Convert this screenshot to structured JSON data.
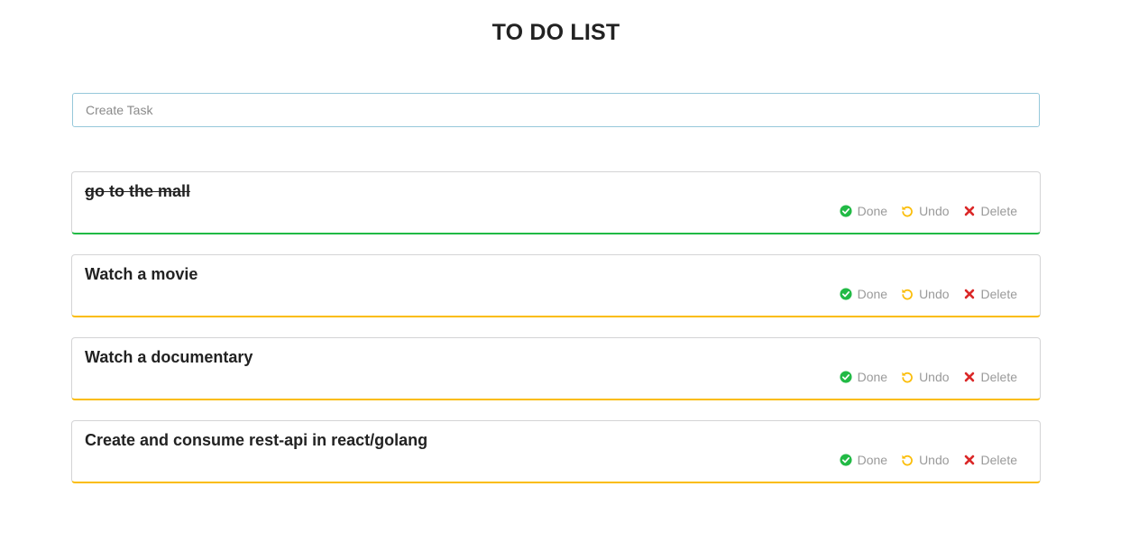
{
  "header": {
    "title": "TO DO LIST"
  },
  "create_task": {
    "placeholder": "Create Task",
    "value": ""
  },
  "actions": {
    "done_label": "Done",
    "undo_label": "Undo",
    "delete_label": "Delete"
  },
  "colors": {
    "done_green": "#21ba45",
    "undo_yellow": "#fbbd08",
    "delete_red": "#db2828"
  },
  "tasks": [
    {
      "text": "go to the mall",
      "status": "done"
    },
    {
      "text": "Watch a movie",
      "status": "pending"
    },
    {
      "text": "Watch a documentary",
      "status": "pending"
    },
    {
      "text": "Create and consume rest-api in react/golang",
      "status": "pending"
    }
  ]
}
